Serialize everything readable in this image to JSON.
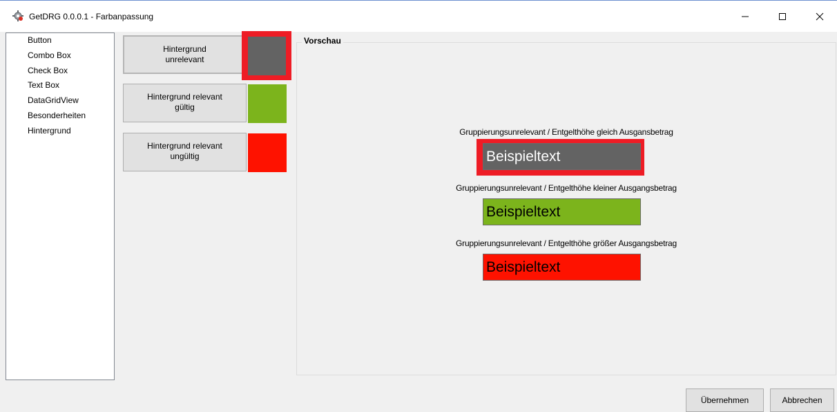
{
  "window": {
    "title": "GetDRG 0.0.0.1 - Farbanpassung",
    "icon": "gear-globe-icon",
    "controls": [
      "minimize-icon",
      "maximize-icon",
      "close-icon"
    ]
  },
  "sidebar": {
    "items": [
      {
        "label": "Button"
      },
      {
        "label": "Combo Box"
      },
      {
        "label": "Check Box"
      },
      {
        "label": "Text Box"
      },
      {
        "label": "DataGridView"
      },
      {
        "label": "Besonderheiten"
      },
      {
        "label": "Hintergrund"
      }
    ]
  },
  "color_buttons": [
    {
      "label_line1": "Hintergrund",
      "label_line2": "unrelevant",
      "swatch_color": "#636363",
      "selected": true
    },
    {
      "label_line1": "Hintergrund relevant",
      "label_line2": "gültig",
      "swatch_color": "#7cb41c"
    },
    {
      "label_line1": "Hintergrund relevant",
      "label_line2": "ungültig",
      "swatch_color": "#fe1200"
    }
  ],
  "preview": {
    "title": "Vorschau",
    "rows": [
      {
        "label": "Gruppierungsunrelevant / Entgelthöhe gleich Ausgansbetrag",
        "sample": "Beispieltext",
        "bg": "#636363",
        "fg": "#ffffff"
      },
      {
        "label": "Gruppierungsunrelevant / Entgelthöhe kleiner Ausgangsbetrag",
        "sample": "Beispieltext",
        "bg": "#7cb41c",
        "fg": "#000000"
      },
      {
        "label": "Gruppierungsunrelevant / Entgelthöhe größer Ausgangsbetrag",
        "sample": "Beispieltext",
        "bg": "#fe1200",
        "fg": "#000000"
      }
    ]
  },
  "footer": {
    "apply_label": "Übernehmen",
    "cancel_label": "Abbrechen"
  },
  "colors": {
    "highlight": "#ee1c25"
  }
}
